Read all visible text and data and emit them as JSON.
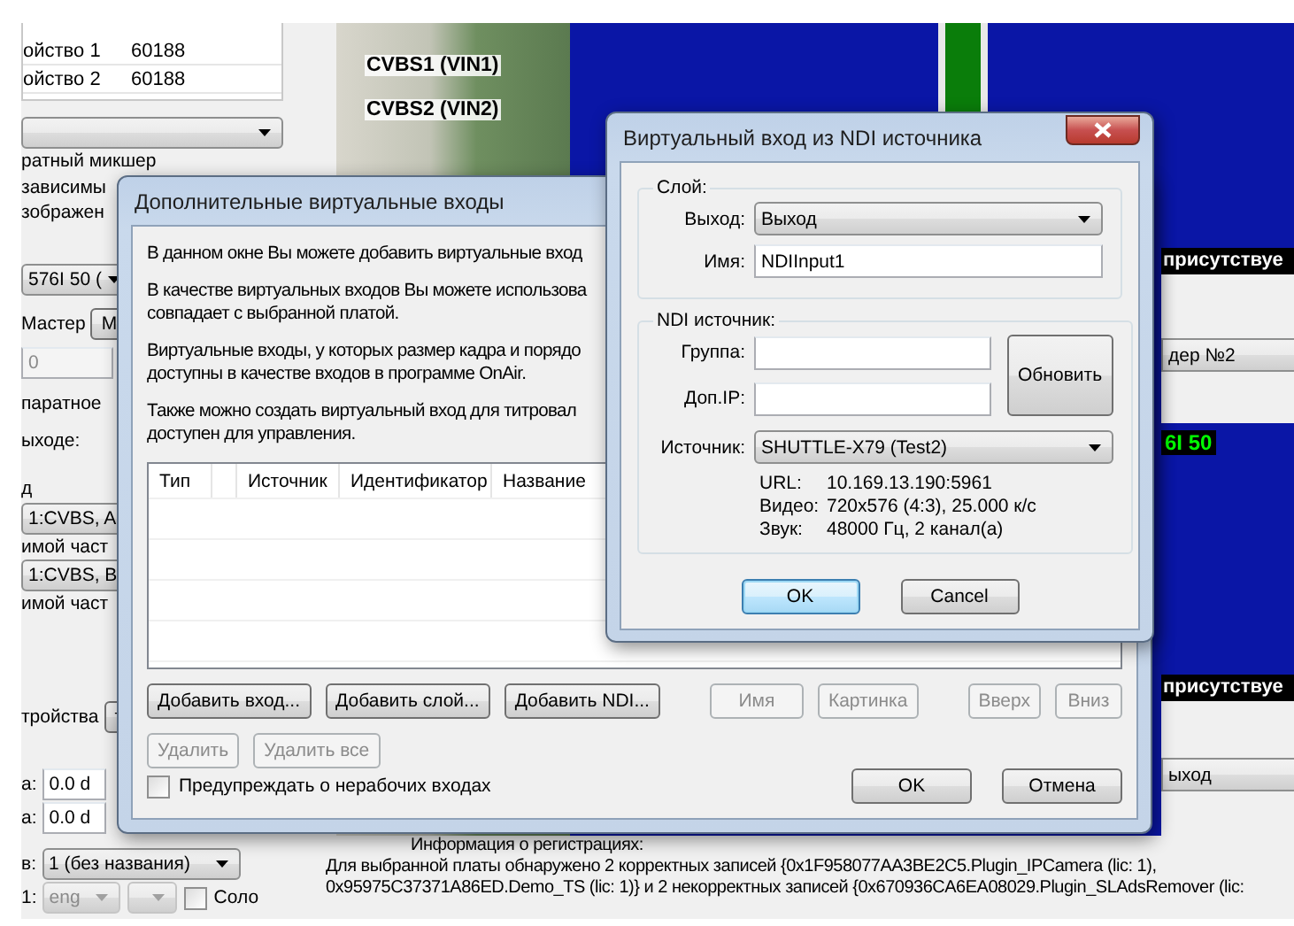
{
  "background": {
    "device_table": {
      "rows": [
        {
          "name": "ойство 1",
          "value": "60188"
        },
        {
          "name": "ойство 2",
          "value": "60188"
        }
      ]
    },
    "left_panel": [
      {
        "kind": "dropdown"
      },
      {
        "kind": "text",
        "text": "ратный микшер"
      },
      {
        "kind": "text",
        "text": "зависимы"
      },
      {
        "kind": "text",
        "text": "зображен"
      },
      {
        "kind": "dropdown",
        "value": "576I 50 ("
      },
      {
        "kind": "button",
        "label": "Мастер"
      },
      {
        "kind": "field",
        "value": "0",
        "disabled": true
      },
      {
        "kind": "text",
        "text": "паратное"
      },
      {
        "kind": "text",
        "text": "ыходе:"
      },
      {
        "kind": "text",
        "text": "д"
      },
      {
        "kind": "dropdown",
        "value": "1:CVBS, A"
      },
      {
        "kind": "text",
        "text": "имой част"
      },
      {
        "kind": "dropdown",
        "value": "1:CVBS, B"
      },
      {
        "kind": "text",
        "text": "имой част"
      },
      {
        "kind": "button",
        "label": "тройства"
      },
      {
        "kind": "field",
        "label": "а:",
        "value": "0.0 d"
      },
      {
        "kind": "field",
        "label": "а:",
        "value": "0.0 d"
      },
      {
        "kind": "dropdown",
        "label": "в:",
        "value": "1 (без названия)"
      },
      {
        "kind": "lang_row",
        "label": "1:",
        "value": "eng",
        "checkbox": "Соло",
        "checked": false
      }
    ],
    "card_photo": {
      "labels": [
        "CVBS1 (VIN1)",
        "CVBS2 (VIN2)"
      ]
    },
    "preview_panel": [
      {
        "kind": "banner",
        "text": "присутствуе"
      },
      {
        "kind": "dropdown",
        "value": "дер №2"
      },
      {
        "kind": "format",
        "text": "6I 50"
      },
      {
        "kind": "banner",
        "text": "присутствуе"
      },
      {
        "kind": "dropdown",
        "value": "ыход"
      }
    ],
    "registration_info": {
      "title": "Информация о регистрациях:",
      "lines": [
        "Для выбранной платы обнаружено 2 корректных записей {0x1F958077AA3BE2C5.Plugin_IPCamera (lic: 1),",
        "0x95975C37371A86ED.Demo_TS (lic: 1)} и 2 некорректных записей {0x670936CA6EA08029.Plugin_SLAdsRemover (lic:"
      ]
    }
  },
  "dialog_inputs": {
    "title": "Дополнительные виртуальные входы",
    "paragraphs": [
      [
        "В данном окне Вы можете добавить виртуальные вход"
      ],
      [
        "В качестве виртуальных входов Вы можете использова",
        "совпадает с выбранной платой."
      ],
      [
        "Виртуальные входы, у которых размер кадра и порядо",
        "доступны в качестве входов в программе OnAir."
      ],
      [
        "Также можно создать виртуальный вход для титровал",
        "доступен для управления."
      ]
    ],
    "table": {
      "columns": [
        "Тип",
        "",
        "Источник",
        "Идентификатор",
        "Название"
      ]
    },
    "button_rows": [
      [
        {
          "label": "Добавить вход...",
          "disabled": false
        },
        {
          "label": "Добавить слой...",
          "disabled": false
        },
        {
          "label": "Добавить NDI...",
          "disabled": false
        },
        {
          "label": "Имя",
          "disabled": true
        },
        {
          "label": "Картинка",
          "disabled": true
        },
        {
          "label": "Вверх",
          "disabled": true
        },
        {
          "label": "Вниз",
          "disabled": true
        }
      ],
      [
        {
          "label": "Удалить",
          "disabled": true
        },
        {
          "label": "Удалить все",
          "disabled": true
        }
      ]
    ],
    "warn_checkbox": {
      "label": "Предупреждать о нерабочих входах",
      "checked": false
    },
    "buttons": [
      {
        "label": "OK",
        "default": false
      },
      {
        "label": "Отмена",
        "default": false
      }
    ]
  },
  "dialog_ndi": {
    "title": "Виртуальный вход из NDI источника",
    "layer_group": {
      "title": "Слой:",
      "output": {
        "label": "Выход:",
        "value": "Выход"
      },
      "name": {
        "label": "Имя:",
        "value": "NDIInput1"
      }
    },
    "ndi_group": {
      "title": "NDI источник:",
      "group": {
        "label": "Группа:"
      },
      "extra_ip": {
        "label": "Доп.IP:"
      },
      "refresh_button": "Обновить",
      "source": {
        "label": "Источник:",
        "value": "SHUTTLE-X79 (Test2)"
      },
      "info": [
        {
          "label": "URL:",
          "value": "10.169.13.190:5961"
        },
        {
          "label": "Видео:",
          "value": "720x576 (4:3), 25.000 к/с"
        },
        {
          "label": "Звук:",
          "value": "48000 Гц, 2 канал(а)"
        }
      ]
    },
    "buttons": [
      {
        "label": "OK",
        "default": true
      },
      {
        "label": "Cancel",
        "default": false
      }
    ]
  }
}
